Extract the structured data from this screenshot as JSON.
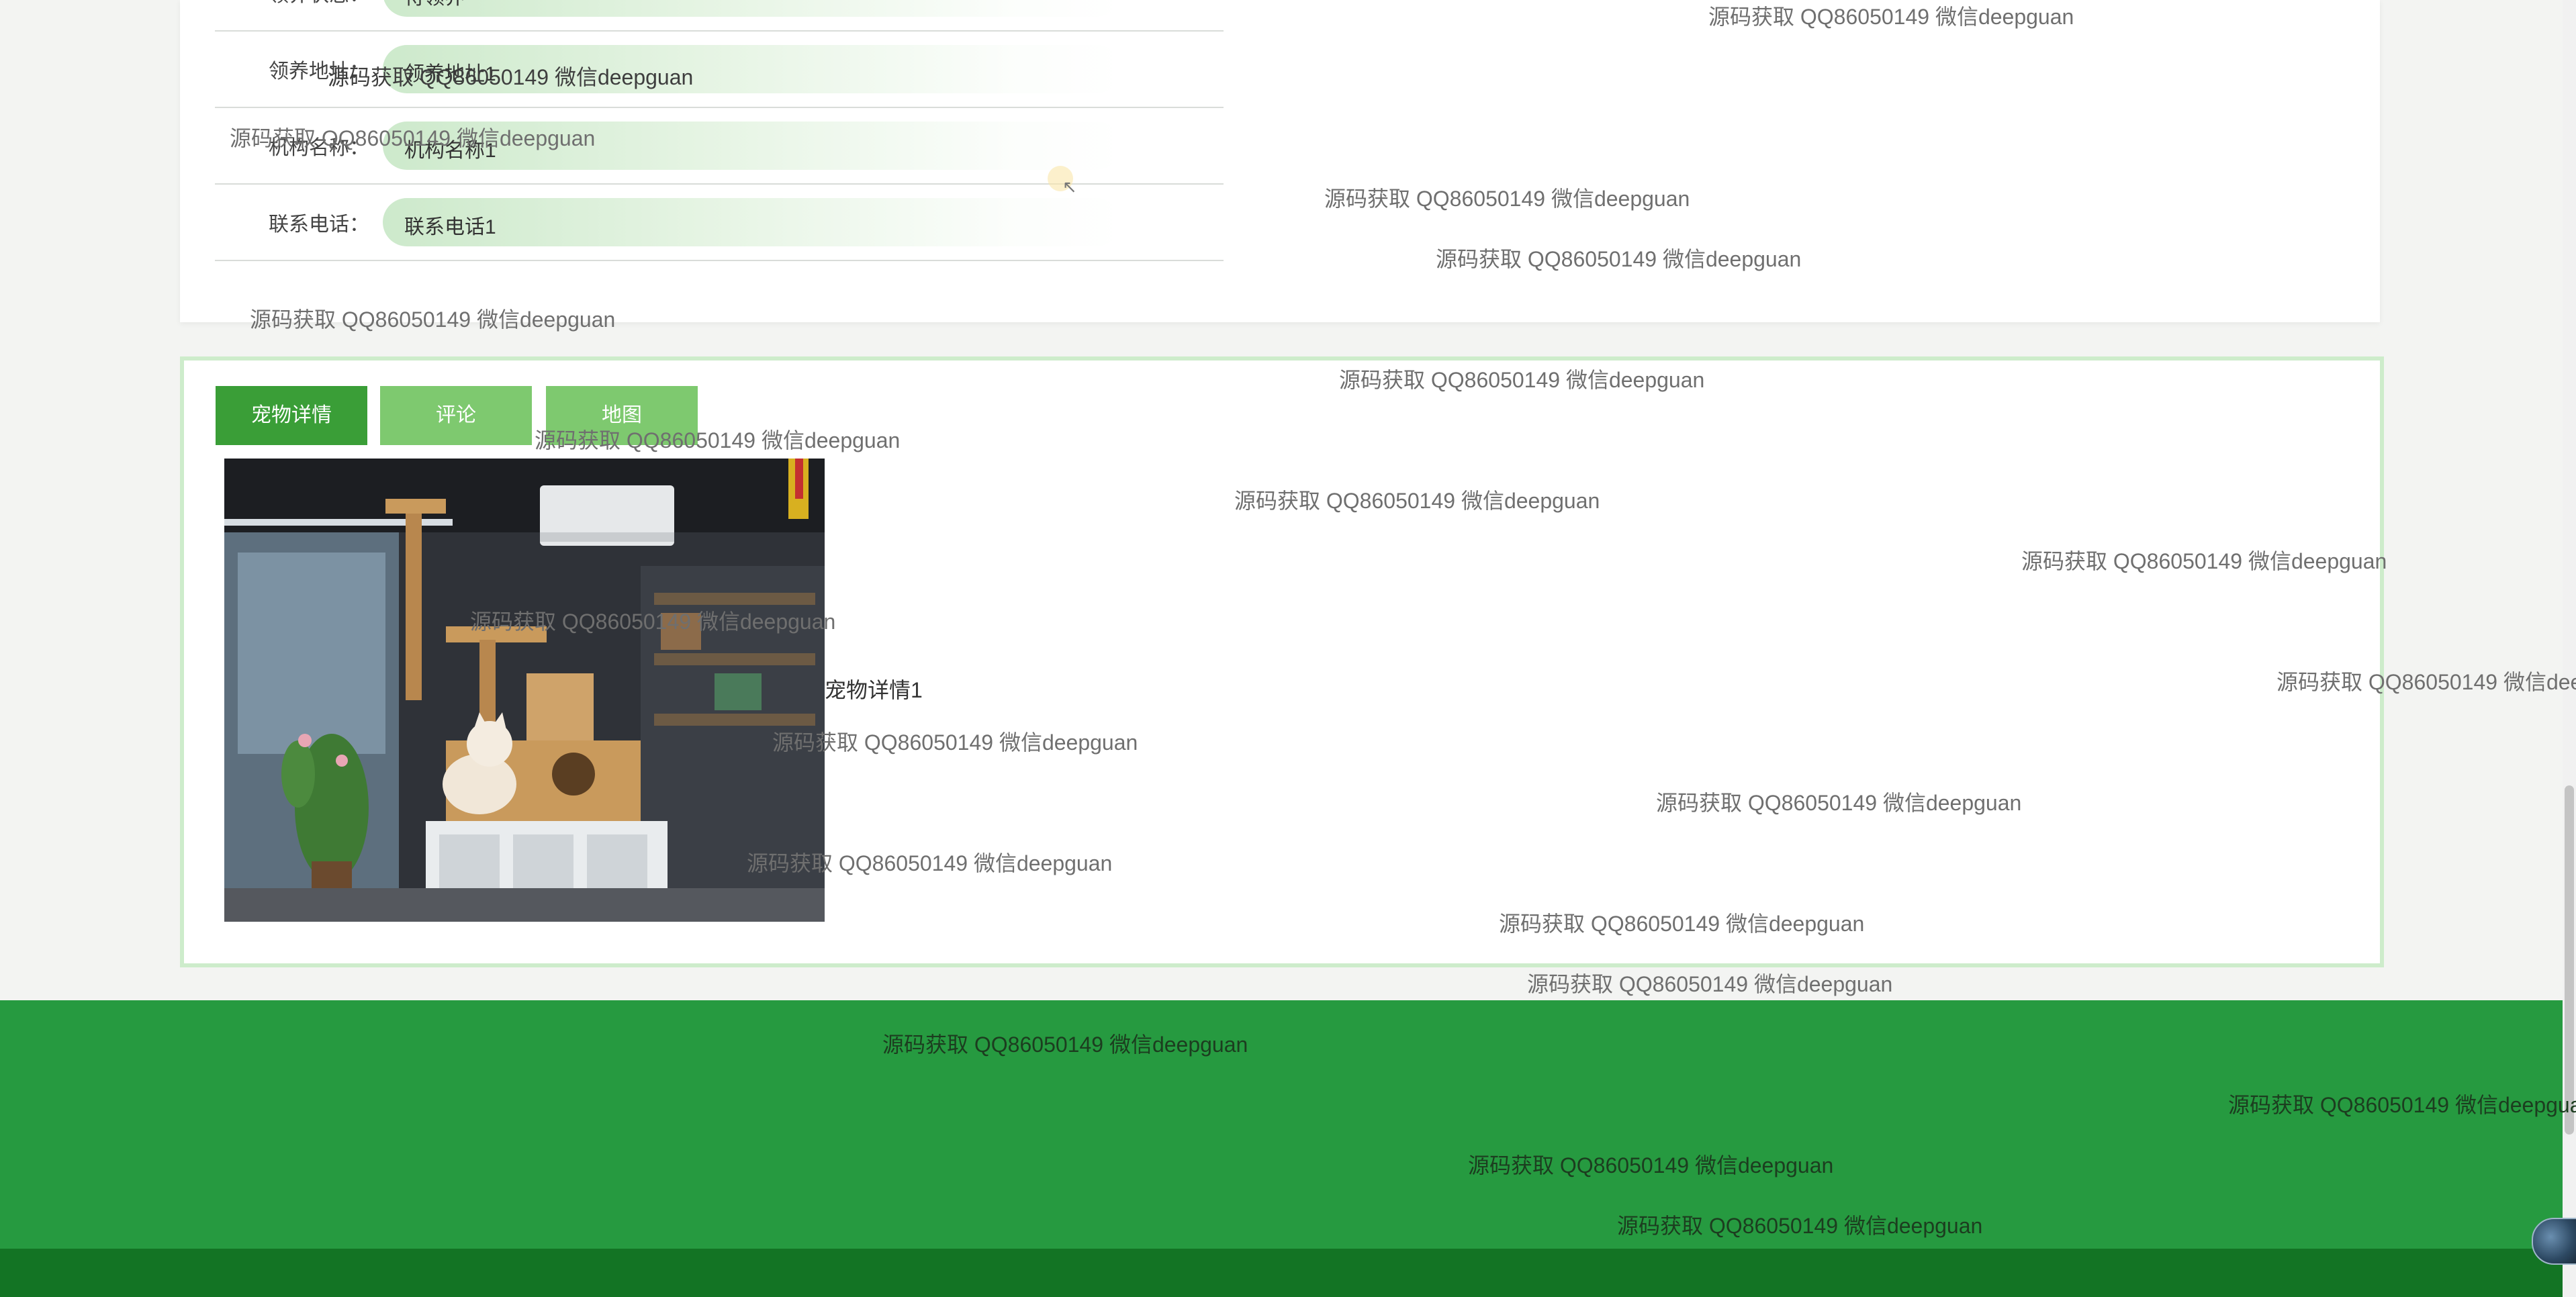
{
  "info": {
    "rows": [
      {
        "label": "领养状态：",
        "value": "待领养"
      },
      {
        "label": "领养地址：",
        "value": "领养地址1"
      },
      {
        "label": "机构名称：",
        "value": "机构名称1"
      },
      {
        "label": "联系电话：",
        "value": "联系电话1"
      }
    ]
  },
  "tabs": {
    "detail": "宠物详情",
    "comment": "评论",
    "map": "地图"
  },
  "pet": {
    "description": "宠物详情1"
  },
  "watermark": "源码获取 QQ86050149 微信deepguan",
  "colors": {
    "primary_green": "#3a9e37",
    "light_green": "#7ec96f",
    "footer_green": "#269a40",
    "footer_dark": "#137424",
    "panel_border": "#cdeccb"
  }
}
